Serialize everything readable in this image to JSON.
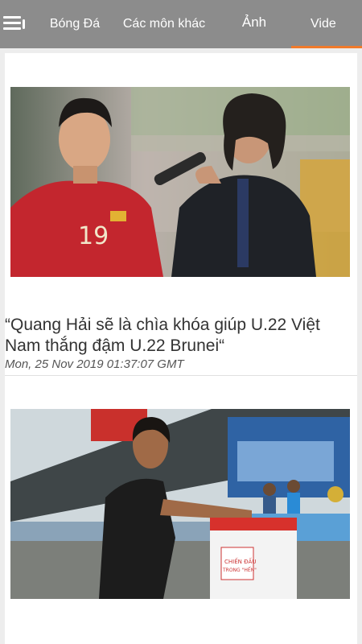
{
  "nav": {
    "tabs": [
      {
        "label": "Bóng Đá"
      },
      {
        "label": "Các môn khác"
      },
      {
        "label": "Ảnh"
      },
      {
        "label": "Vide"
      }
    ],
    "active_tab_index": 3,
    "accent_color": "#f07a2b",
    "bar_color": "#8c8c8c",
    "menu_icon": "hamburger-menu-icon"
  },
  "articles": [
    {
      "title": "“Quang Hải sẽ là chìa khóa giúp U.22 Việt Nam thắng đậm U.22 Brunei“",
      "published": "Mon, 25 Nov 2019 01:37:07 GMT"
    }
  ],
  "thumbnail_2": {
    "sign": "CHIẾN ĐẤU",
    "sign2": "TRONG \"HẾN\""
  }
}
